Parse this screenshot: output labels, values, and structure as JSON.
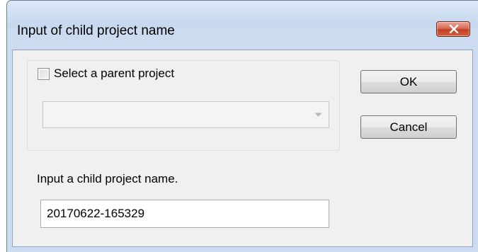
{
  "window": {
    "title": "Input of child project name",
    "close_icon": "close-x-icon"
  },
  "parent_group": {
    "checkbox_label": "Select a parent project",
    "checkbox_checked": false,
    "parent_project_select": {
      "selected_value": "",
      "enabled": false,
      "arrow_icon": "chevron-down-icon"
    }
  },
  "buttons": {
    "ok_label": "OK",
    "cancel_label": "Cancel"
  },
  "child_name": {
    "prompt": "Input a child project name.",
    "value": "20170622-165329"
  },
  "colors": {
    "titlebar": "#cfdff2",
    "client_background": "#f0f0f0",
    "close_button": "#c94a2f"
  }
}
